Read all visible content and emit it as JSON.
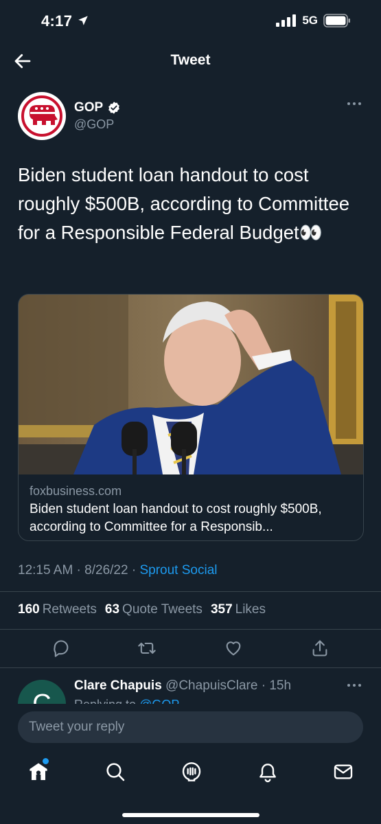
{
  "status_bar": {
    "time": "4:17",
    "network": "5G"
  },
  "header": {
    "title": "Tweet"
  },
  "tweet": {
    "author_name": "GOP",
    "author_handle": "@GOP",
    "text": "Biden student loan handout to cost roughly $500B, according to Committee for a Responsible Federal Budget👀",
    "card": {
      "domain": "foxbusiness.com",
      "title": "Biden student loan handout to cost roughly $500B, according to Committee for a Responsib..."
    },
    "time": "12:15 AM",
    "date": "8/26/22",
    "source": "Sprout Social",
    "retweets_count": "160",
    "retweets_label": "Retweets",
    "quotes_count": "63",
    "quotes_label": "Quote Tweets",
    "likes_count": "357",
    "likes_label": "Likes"
  },
  "reply": {
    "avatar_letter": "C",
    "name": "Clare Chapuis",
    "handle": "@ChapuisClare",
    "age": "15h",
    "replying_prefix": "Replying to",
    "replying_to": "@GOP"
  },
  "composer": {
    "placeholder": "Tweet your reply"
  },
  "colors": {
    "background": "#15202b",
    "accent": "#1d9bf0",
    "muted": "#8b98a5"
  },
  "tabbar": {
    "icons": [
      "home-icon",
      "search-icon",
      "spaces-icon",
      "notifications-icon",
      "messages-icon"
    ]
  }
}
